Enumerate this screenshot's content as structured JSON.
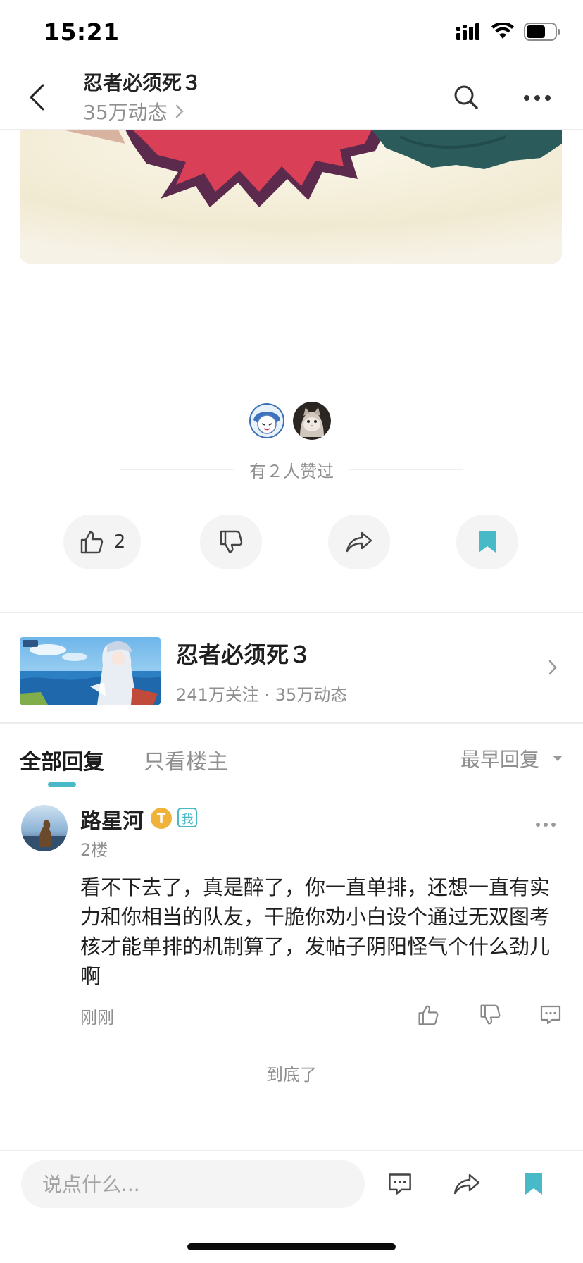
{
  "status_bar": {
    "time": "15:21"
  },
  "header": {
    "title": "忍者必须死３",
    "subtitle": "35万动态"
  },
  "likes": {
    "liked_text": "有２人赞过",
    "like_count": "2"
  },
  "forum": {
    "name": "忍者必须死３",
    "stats": "241万关注 · 35万动态"
  },
  "tabs": {
    "all": "全部回复",
    "op_only": "只看楼主",
    "sort": "最早回复"
  },
  "reply": {
    "author": "路星河",
    "badge_t": "T",
    "badge_me": "我",
    "floor": "2楼",
    "text": "看不下去了，真是醉了，你一直单排，还想一直有实力和你相当的队友，干脆你劝小白设个通过无双图考核才能单排的机制算了，发帖子阴阳怪气个什么劲儿啊",
    "time": "刚刚"
  },
  "end_text": "到底了",
  "composer": {
    "placeholder": "说点什么..."
  },
  "colors": {
    "accent": "#48b9c7",
    "badge_gold": "#f1b23a"
  }
}
